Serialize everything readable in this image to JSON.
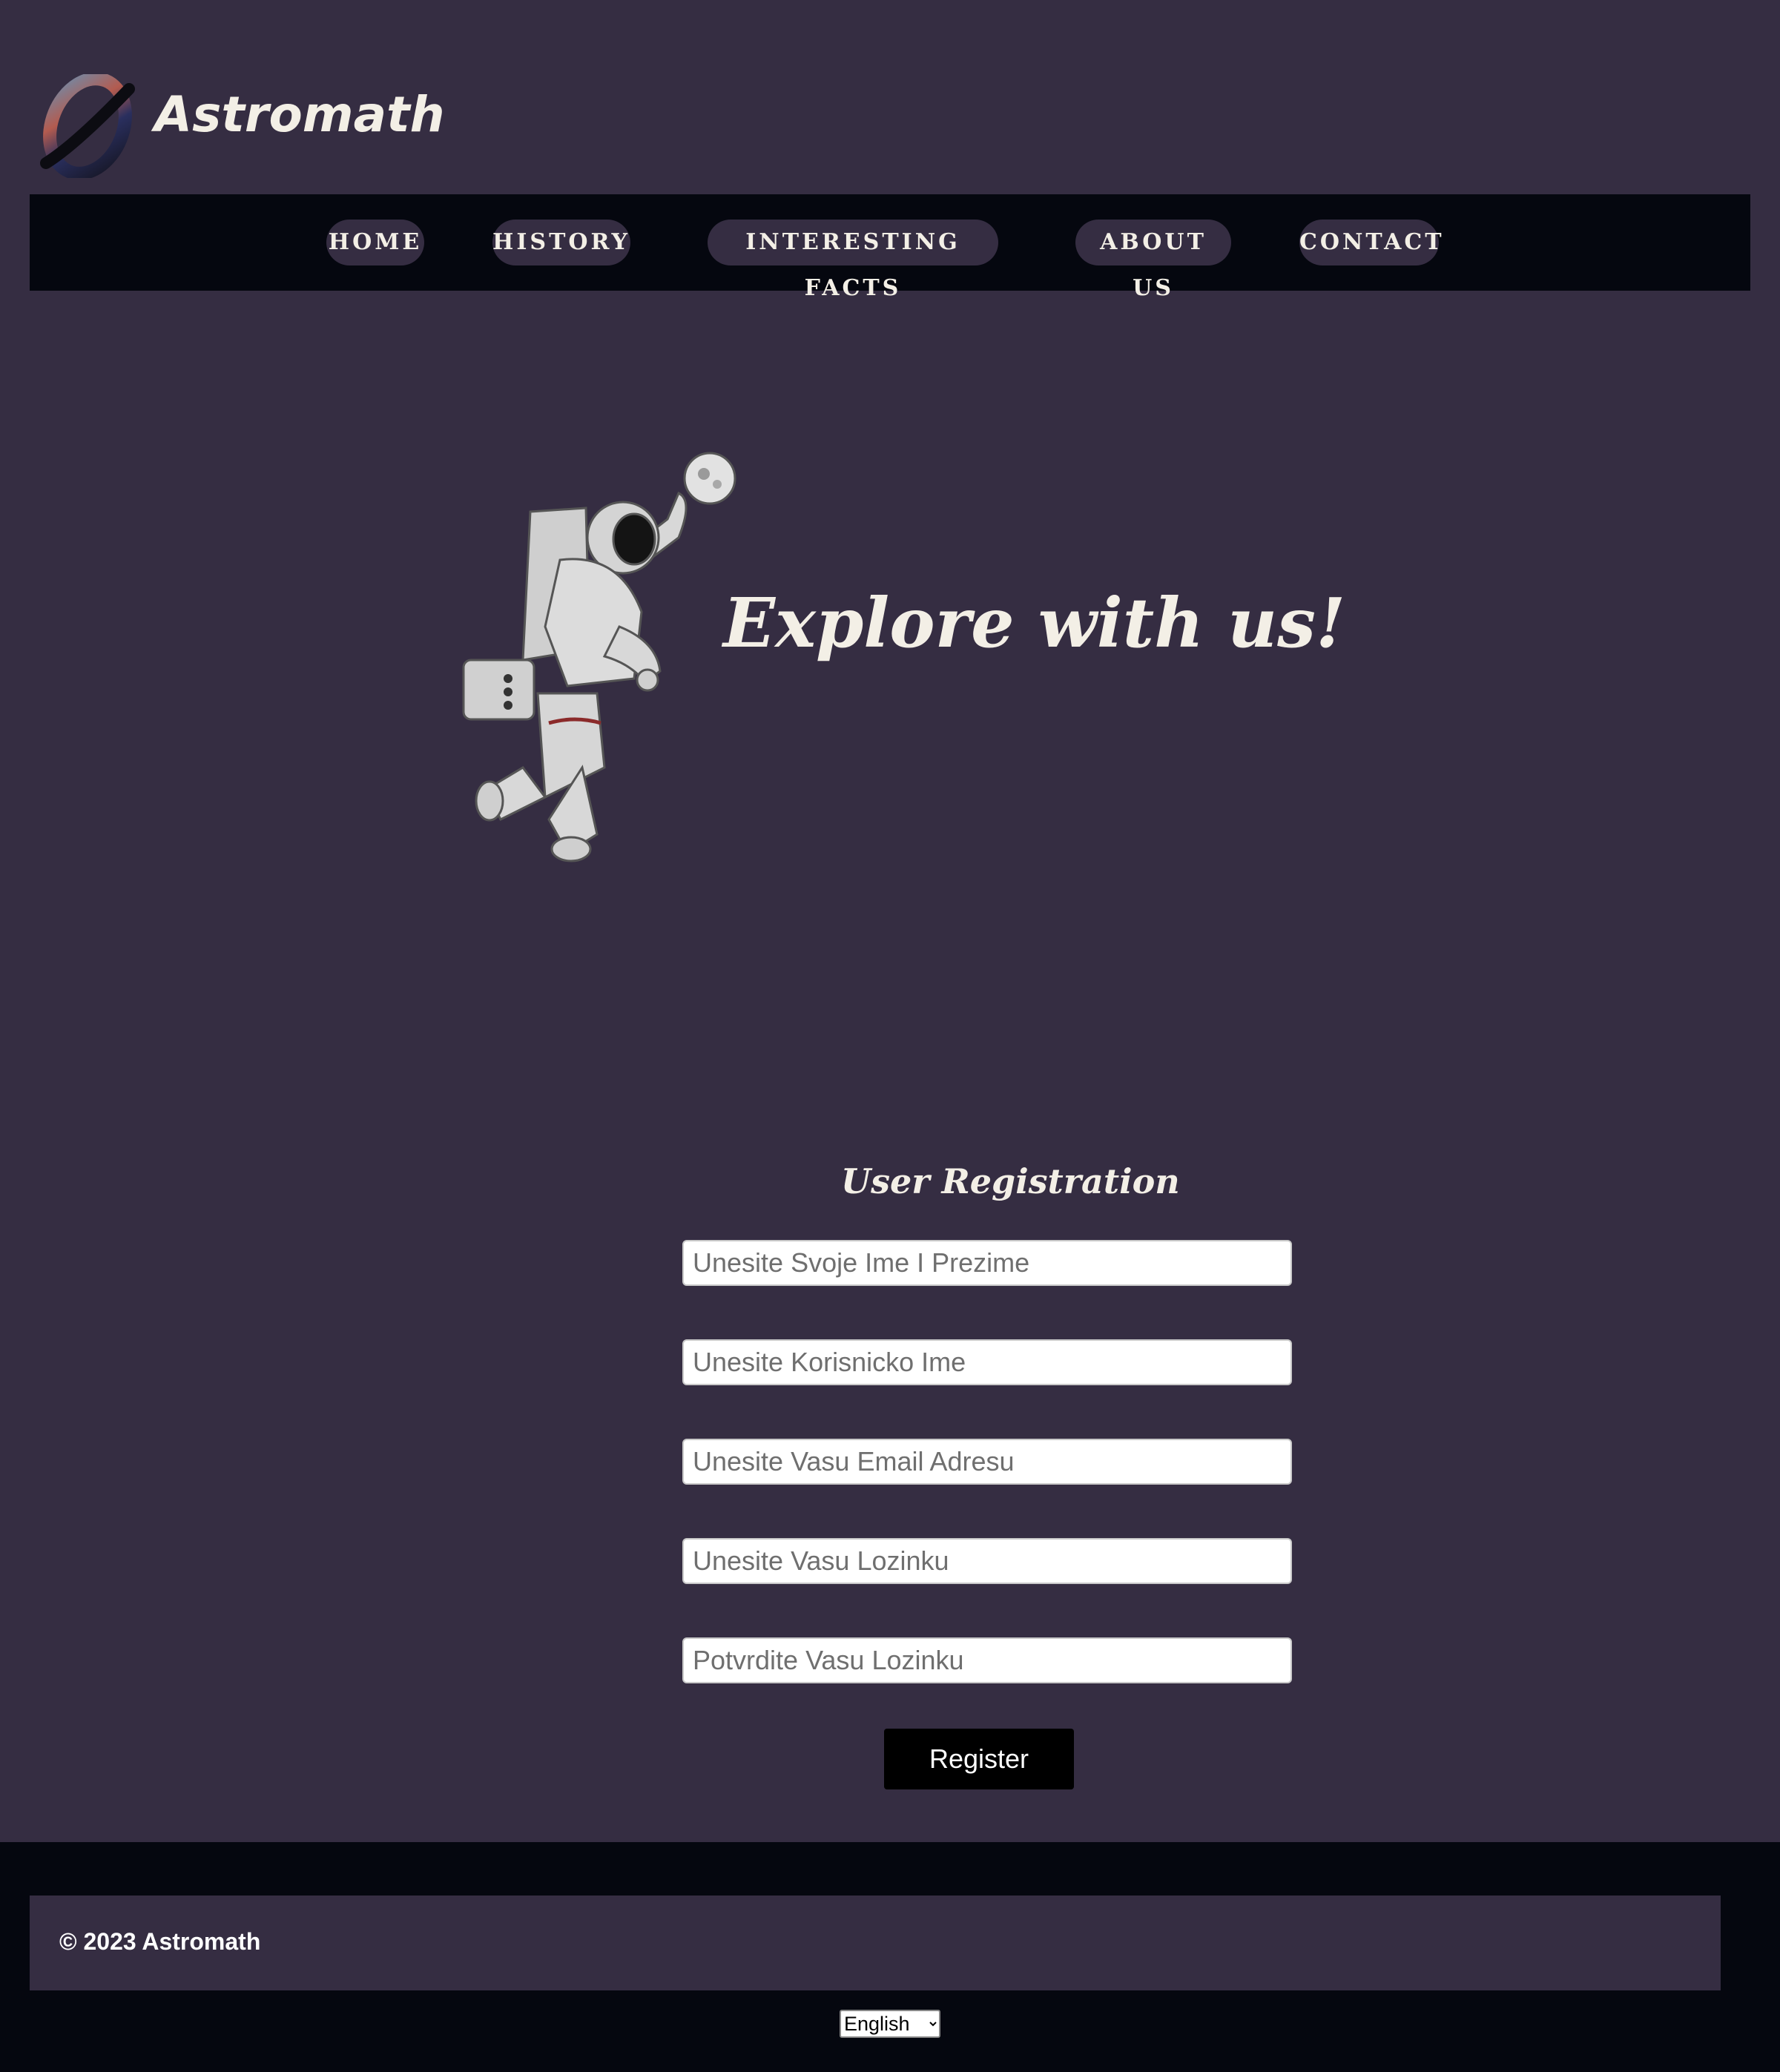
{
  "header": {
    "brand": "Astromath"
  },
  "nav": {
    "items": [
      {
        "label": "HOME"
      },
      {
        "label": "HISTORY"
      },
      {
        "label": "INTERESTING FACTS"
      },
      {
        "label": "ABOUT US"
      },
      {
        "label": "CONTACT"
      }
    ]
  },
  "hero": {
    "title": "Explore with us!"
  },
  "form": {
    "title": "User Registration",
    "fields": [
      {
        "placeholder": "Unesite Svoje Ime I Prezime",
        "value": ""
      },
      {
        "placeholder": "Unesite Korisnicko Ime",
        "value": ""
      },
      {
        "placeholder": "Unesite Vasu Email Adresu",
        "value": ""
      },
      {
        "placeholder": "Unesite Vasu Lozinku",
        "value": ""
      },
      {
        "placeholder": "Potvrdite Vasu Lozinku",
        "value": ""
      }
    ],
    "submit_label": "Register"
  },
  "footer": {
    "copyright": "© 2023 Astromath",
    "language": {
      "selected": "English"
    }
  },
  "colors": {
    "background": "#352d42",
    "nav_background": "#05070f",
    "heading_text": "#f3efe6",
    "button_background": "#000000"
  },
  "icons": {
    "logo": "astromath-logo-icon",
    "hero": "astronaut-illustration"
  }
}
